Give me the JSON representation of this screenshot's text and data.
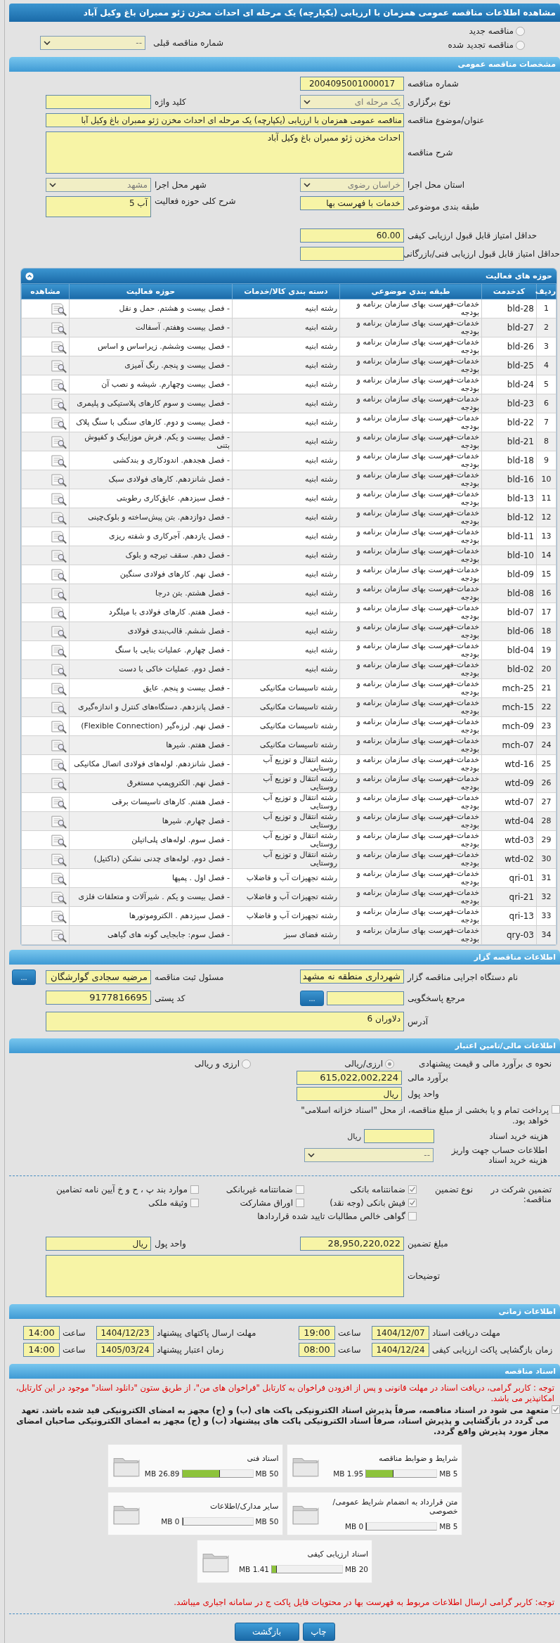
{
  "title": "مشاهده اطلاعات مناقصه عمومی همزمان با ارزیابی (یکپارچه) یک مرحله ای احداث مخزن ژئو ممبران باغ وکیل آباد",
  "tender_status": [
    {
      "label": "مناقصه جدید",
      "selected": false
    },
    {
      "label": "مناقصه تجدید شده",
      "selected": false
    }
  ],
  "previous_tender": {
    "label": "شماره مناقصه قبلی",
    "value": "--"
  },
  "general": {
    "header": "مشخصات مناقصه عمومی",
    "tender_number": {
      "label": "شماره مناقصه",
      "value": "2004095001000017"
    },
    "holding_type": {
      "label": "نوع برگزاری",
      "value": "یک مرحله ای"
    },
    "keyword": {
      "label": "کلید واژه"
    },
    "subject": {
      "label": "عنوان/موضوع مناقصه",
      "value": "مناقصه عمومی همزمان با ارزیابی (یکپارچه) یک مرحله ای احداث مخزن ژئو ممبران باغ وکیل آبا"
    },
    "description": {
      "label": "شرح مناقصه",
      "value": "احداث مخزن ژئو ممبران باغ وکیل آباد"
    },
    "province": {
      "label": "استان محل اجرا",
      "value": "خراسان رضوی"
    },
    "city": {
      "label": "شهر محل اجرا",
      "value": "مشهد"
    },
    "subject_class": {
      "label": "طبقه بندی موضوعی",
      "value": "خدمات با فهرست بها"
    },
    "activity_summary": {
      "label": "شرح کلی حوزه فعالیت",
      "value": "آب 5"
    },
    "min_quality_score": {
      "label": "حداقل امتیاز قابل قبول ارزیابی کیفی",
      "value": "60.00"
    },
    "min_technical_score": {
      "label": "حداقل امتیاز قابل قبول ارزیابی فنی/بازرگانی"
    }
  },
  "activities": {
    "header": "حوزه های فعالیت",
    "columns": [
      "ردیف",
      "کدخدمت",
      "طبقه بندی موضوعی",
      "دسته بندی کالا/خدمات",
      "حوزه فعالیت",
      "مشاهده"
    ],
    "rows": [
      {
        "no": "1",
        "code": "bld-28",
        "classification": "خدمات-فهرست بهای سازمان برنامه و بودجه",
        "category": "رشته ابنیه",
        "activity": "- فصل بیست و هشتم. حمل و نقل"
      },
      {
        "no": "2",
        "code": "bld-27",
        "classification": "خدمات-فهرست بهای سازمان برنامه و بودجه",
        "category": "رشته ابنیه",
        "activity": "- فصل بیست وهفتم. آسفالت"
      },
      {
        "no": "3",
        "code": "bld-26",
        "classification": "خدمات-فهرست بهای سازمان برنامه و بودجه",
        "category": "رشته ابنیه",
        "activity": "- فصل بیست وششم. زیراساس و اساس"
      },
      {
        "no": "4",
        "code": "bld-25",
        "classification": "خدمات-فهرست بهای سازمان برنامه و بودجه",
        "category": "رشته ابنیه",
        "activity": "- فصل بیست و پنجم. رنگ آمیزی"
      },
      {
        "no": "5",
        "code": "bld-24",
        "classification": "خدمات-فهرست بهای سازمان برنامه و بودجه",
        "category": "رشته ابنیه",
        "activity": "- فصل بیست وچهارم. شیشه و نصب آن"
      },
      {
        "no": "6",
        "code": "bld-23",
        "classification": "خدمات-فهرست بهای سازمان برنامه و بودجه",
        "category": "رشته ابنیه",
        "activity": "- فصل بیست و سوم کارهای پلاستیکی و پلیمری"
      },
      {
        "no": "7",
        "code": "bld-22",
        "classification": "خدمات-فهرست بهای سازمان برنامه و بودجه",
        "category": "رشته ابنیه",
        "activity": "- فصل بیست و دوم. کارهای سنگی با سنگ پلاک"
      },
      {
        "no": "8",
        "code": "bld-21",
        "classification": "خدمات-فهرست بهای سازمان برنامه و بودجه",
        "category": "رشته ابنیه",
        "activity": "- فصل بیست و یکم. فرش موزاییک و کفپوش بتنی"
      },
      {
        "no": "9",
        "code": "bld-18",
        "classification": "خدمات-فهرست بهای سازمان برنامه و بودجه",
        "category": "رشته ابنیه",
        "activity": "- فصل هجدهم. اندودکاری و بندکشی"
      },
      {
        "no": "10",
        "code": "bld-16",
        "classification": "خدمات-فهرست بهای سازمان برنامه و بودجه",
        "category": "رشته ابنیه",
        "activity": "- فصل شانزدهم. کارهای فولادی سبک"
      },
      {
        "no": "11",
        "code": "bld-13",
        "classification": "خدمات-فهرست بهای سازمان برنامه و بودجه",
        "category": "رشته ابنیه",
        "activity": "- فصل سیزدهم. عایق‌کاری رطوبتی"
      },
      {
        "no": "12",
        "code": "bld-12",
        "classification": "خدمات-فهرست بهای سازمان برنامه و بودجه",
        "category": "رشته ابنیه",
        "activity": "- فصل دوازدهم. بتن پیش‌ساخته و بلوک‌چینی"
      },
      {
        "no": "13",
        "code": "bld-11",
        "classification": "خدمات-فهرست بهای سازمان برنامه و بودجه",
        "category": "رشته ابنیه",
        "activity": "- فصل یازدهم. آجرکاری و شفته ریزی"
      },
      {
        "no": "14",
        "code": "bld-10",
        "classification": "خدمات-فهرست بهای سازمان برنامه و بودجه",
        "category": "رشته ابنیه",
        "activity": "- فصل دهم. سقف تیرچه و بلوک"
      },
      {
        "no": "15",
        "code": "bld-09",
        "classification": "خدمات-فهرست بهای سازمان برنامه و بودجه",
        "category": "رشته ابنیه",
        "activity": "- فصل نهم. کارهای فولادی سنگین"
      },
      {
        "no": "16",
        "code": "bld-08",
        "classification": "خدمات-فهرست بهای سازمان برنامه و بودجه",
        "category": "رشته ابنیه",
        "activity": "- فصل هشتم. بتن درجا"
      },
      {
        "no": "17",
        "code": "bld-07",
        "classification": "خدمات-فهرست بهای سازمان برنامه و بودجه",
        "category": "رشته ابنیه",
        "activity": "- فصل هفتم. کارهای فولادی با میلگرد"
      },
      {
        "no": "18",
        "code": "bld-06",
        "classification": "خدمات-فهرست بهای سازمان برنامه و بودجه",
        "category": "رشته ابنیه",
        "activity": "- فصل ششم. قالب‌بندی فولادی"
      },
      {
        "no": "19",
        "code": "bld-04",
        "classification": "خدمات-فهرست بهای سازمان برنامه و بودجه",
        "category": "رشته ابنیه",
        "activity": "- فصل چهارم. عملیات بنایی با سنگ"
      },
      {
        "no": "20",
        "code": "bld-02",
        "classification": "خدمات-فهرست بهای سازمان برنامه و بودجه",
        "category": "رشته ابنیه",
        "activity": "- فصل دوم. عملیات خاکی با دست"
      },
      {
        "no": "21",
        "code": "mch-25",
        "classification": "خدمات-فهرست بهای سازمان برنامه و بودجه",
        "category": "رشته تاسیسات مکانیکی",
        "activity": "- فصل بیست و پنجم. عایق"
      },
      {
        "no": "22",
        "code": "mch-15",
        "classification": "خدمات-فهرست بهای سازمان برنامه و بودجه",
        "category": "رشته تاسیسات مکانیکی",
        "activity": "- فصل پانزدهم. دستگاه‌های کنترل و اندازه‌گیری"
      },
      {
        "no": "23",
        "code": "mch-09",
        "classification": "خدمات-فهرست بهای سازمان برنامه و بودجه",
        "category": "رشته تاسیسات مکانیکی",
        "activity": "- فصل نهم. لرزه‌گیر (Flexible Connection)"
      },
      {
        "no": "24",
        "code": "mch-07",
        "classification": "خدمات-فهرست بهای سازمان برنامه و بودجه",
        "category": "رشته تاسیسات مکانیکی",
        "activity": "- فصل هفتم. شیرها"
      },
      {
        "no": "25",
        "code": "wtd-16",
        "classification": "خدمات-فهرست بهای سازمان برنامه و بودجه",
        "category": "رشته انتقال و توزیع آب روستایی",
        "activity": "- فصل شانزدهم. لوله‌های فولادی اتصال مکانیکی"
      },
      {
        "no": "26",
        "code": "wtd-09",
        "classification": "خدمات-فهرست بهای سازمان برنامه و بودجه",
        "category": "رشته انتقال و توزیع آب روستایی",
        "activity": "- فصل نهم. الکتروپمپ مستغرق"
      },
      {
        "no": "27",
        "code": "wtd-07",
        "classification": "خدمات-فهرست بهای سازمان برنامه و بودجه",
        "category": "رشته انتقال و توزیع آب روستایی",
        "activity": "- فصل هفتم. کارهای تاسیسات برقی"
      },
      {
        "no": "28",
        "code": "wtd-04",
        "classification": "خدمات-فهرست بهای سازمان برنامه و بودجه",
        "category": "رشته انتقال و توزیع آب روستایی",
        "activity": "- فصل چهارم. شیرها"
      },
      {
        "no": "29",
        "code": "wtd-03",
        "classification": "خدمات-فهرست بهای سازمان برنامه و بودجه",
        "category": "رشته انتقال و توزیع آب روستایی",
        "activity": "- فصل سوم. لوله‌های پلی‌اتیلن"
      },
      {
        "no": "30",
        "code": "wtd-02",
        "classification": "خدمات-فهرست بهای سازمان برنامه و بودجه",
        "category": "رشته انتقال و توزیع آب روستایی",
        "activity": "- فصل دوم. لوله‌های چدنی نشکن (داکتیل)"
      },
      {
        "no": "31",
        "code": "qri-01",
        "classification": "خدمات-فهرست بهای سازمان برنامه و بودجه",
        "category": "رشته تجهیزات آب و فاضلاب",
        "activity": "- فصل اول . پمپها"
      },
      {
        "no": "32",
        "code": "qri-21",
        "classification": "خدمات-فهرست بهای سازمان برنامه و بودجه",
        "category": "رشته تجهیزات آب و فاضلاب",
        "activity": "- فصل بیست و یکم . شیرآلات و متعلقات فلزی"
      },
      {
        "no": "33",
        "code": "qri-13",
        "classification": "خدمات-فهرست بهای سازمان برنامه و بودجه",
        "category": "رشته تجهیزات آب و فاضلاب",
        "activity": "- فصل سیزدهم . الکتروموتورها"
      },
      {
        "no": "34",
        "code": "qry-03",
        "classification": "خدمات-فهرست بهای سازمان برنامه و بودجه",
        "category": "رشته فضای سبز",
        "activity": "- فصل سوم: جابجایی گونه های گیاهی"
      }
    ]
  },
  "tenderer": {
    "header": "اطلاعات مناقصه گزار",
    "organization": {
      "label": "نام دستگاه اجرایی مناقصه گزار",
      "value": "شهرداری منطقه نه مشهد"
    },
    "registrar": {
      "label": "مسئول ثبت مناقصه",
      "value": "مرضیه سجادی گوارشگان",
      "button": "..."
    },
    "responder": {
      "label": "مرجع پاسخگویی",
      "button": "..."
    },
    "postal_code": {
      "label": "کد پستی",
      "value": "9177816695"
    },
    "address": {
      "label": "آدرس",
      "value": "دلاوران 6"
    }
  },
  "finance": {
    "header": "اطلاعات مالی/تامین اعتبار",
    "pricing": {
      "label": "نحوه ی برآورد مالی و قیمت پیشنهادی",
      "options": [
        {
          "label": "ارزی/ریالی",
          "selected": true
        },
        {
          "label": "ارزی و ریالی",
          "selected": false
        }
      ]
    },
    "estimate": {
      "label": "برآورد مالی",
      "value": "615,022,002,224"
    },
    "currency": {
      "label": "واحد پول",
      "value": "ریال"
    },
    "treasury": {
      "label": "پرداخت تمام و یا بخشی از مبلغ مناقصه، از محل \"اسناد خزانه اسلامی\" خواهد بود.",
      "checked": false
    },
    "document_fee": {
      "label": "هزینه خرید اسناد",
      "unit": "ریال"
    },
    "fee_account": {
      "label": "اطلاعات حساب جهت واریز هزینه خرید اسناد",
      "value": "--"
    }
  },
  "guarantee": {
    "label": "تضمین شرکت در مناقصه:",
    "type_label": "نوع تضمین",
    "options": [
      {
        "label": "ضمانتنامه بانکی",
        "checked": true
      },
      {
        "label": "ضمانتنامه غیربانکی",
        "checked": false
      },
      {
        "label": "موارد بند پ ، ح و خ آیین نامه تضامین",
        "checked": false
      },
      {
        "label": "فیش بانکی (وجه نقد)",
        "checked": true
      },
      {
        "label": "اوراق مشارکت",
        "checked": false
      },
      {
        "label": "وثیقه ملکی",
        "checked": false
      },
      {
        "label": "گواهی خالص مطالبات تایید شده قراردادها",
        "checked": false
      }
    ],
    "amount": {
      "label": "مبلغ تضمین",
      "value": "28,950,220,022"
    },
    "currency": {
      "label": "واحد پول",
      "value": "ریال"
    },
    "notes": {
      "label": "توضیحات"
    }
  },
  "timing": {
    "header": "اطلاعات زمانی",
    "items": [
      {
        "label": "مهلت دریافت اسناد",
        "date": "1404/12/07",
        "time_label": "ساعت",
        "time": "19:00"
      },
      {
        "label": "مهلت ارسال پاکتهای پیشنهاد",
        "date": "1404/12/23",
        "time_label": "ساعت",
        "time": "14:00"
      },
      {
        "label": "زمان بازگشایی پاکت ارزیابی کیفی",
        "date": "1404/12/24",
        "time_label": "ساعت",
        "time": "08:00"
      },
      {
        "label": "زمان اعتبار پیشنهاد",
        "date": "1405/03/24",
        "time_label": "ساعت",
        "time": "14:00"
      }
    ]
  },
  "documents": {
    "header": "اسناد مناقصه",
    "notice": "توجه : کاربر گرامی، دریافت اسناد در مهلت قانونی و پس از افزودن فراخوان به کارتابل \"فراخوان های من\"، از طریق ستون \"دانلود اسناد\" موجود در این کارتابل، امکانپذیر می باشد.",
    "commitment": {
      "text": "متعهد می شود در اسناد مناقصه، صرفاً پذیرش اسناد الکترونیکی پاکت های (ب) و (ج) مجهز به امضای الکترونیکی قید شده باشد. تعهد می گردد در بازگشایی و پذیرش اسناد، صرفاً اسناد الکترونیکی پاکت های پیشنهاد (ب) و (ج) مجهز به امضای الکترونیکی صاحبان امضای مجاز مورد پذیرش واقع گردد.",
      "checked": true
    },
    "files": [
      {
        "title": "شرایط و ضوابط مناقصه",
        "max": "5 MB",
        "used": "1.95 MB",
        "level": 0.39
      },
      {
        "title": "اسناد فنی",
        "max": "50 MB",
        "used": "26.89 MB",
        "level": 0.538
      },
      {
        "title": "متن قرارداد به انضمام شرایط عمومی/خصوصی",
        "max": "5 MB",
        "used": "0 MB",
        "level": 0
      },
      {
        "title": "سایر مدارک/اطلاعات",
        "max": "50 MB",
        "used": "0 MB",
        "level": 0
      },
      {
        "title": "اسناد ارزیابی کیفی",
        "max": "20 MB",
        "used": "1.41 MB",
        "level": 0.07
      }
    ],
    "footer_note": "توجه: کاربر گرامی ارسال اطلاعات مربوط به فهرست بها در محتویات فایل پاکت ج در سامانه اجباری میباشد."
  },
  "buttons": [
    "چاپ",
    "بازگشت"
  ]
}
